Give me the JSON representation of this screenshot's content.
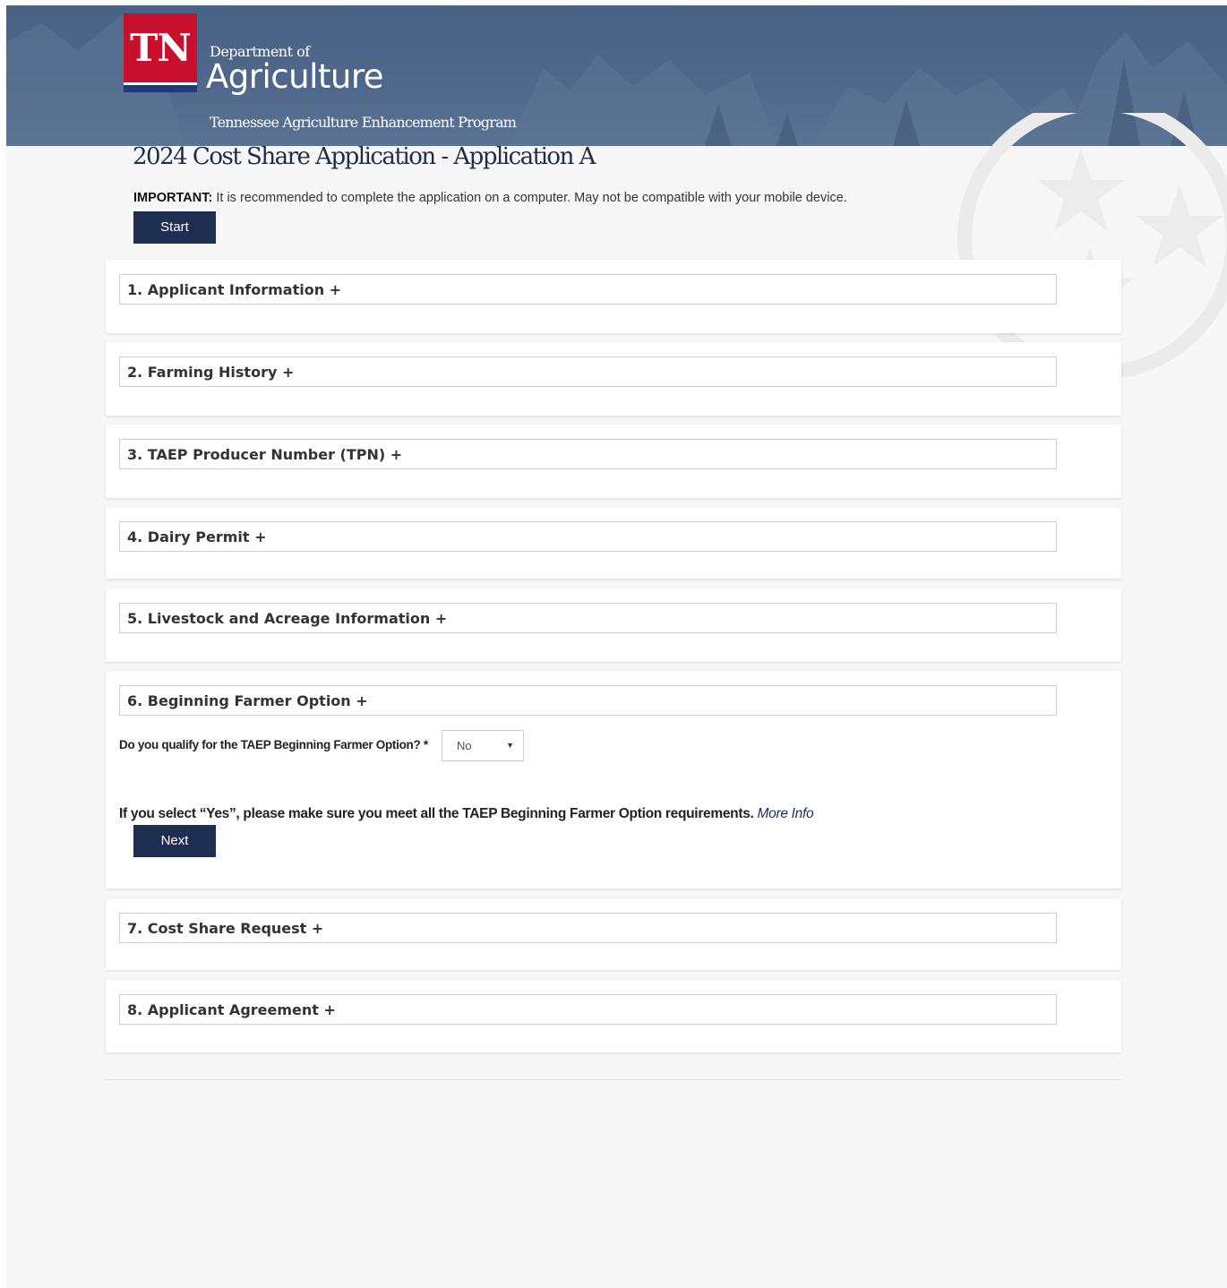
{
  "header": {
    "logo_text": "TN",
    "department": "Department of",
    "agency": "Agriculture",
    "program": "Tennessee Agriculture Enhancement Program"
  },
  "page": {
    "title": "2024 Cost Share Application - Application A",
    "important_label": "IMPORTANT:",
    "important_text": " It is recommended to complete the application on a computer. May not be compatible with your mobile device.",
    "start_label": "Start"
  },
  "sections": [
    {
      "label": "1. Applicant Information +"
    },
    {
      "label": "2. Farming History +"
    },
    {
      "label": "3. TAEP Producer Number (TPN) +"
    },
    {
      "label": "4.  Dairy Permit +"
    },
    {
      "label": "5. Livestock and Acreage Information +"
    },
    {
      "label": "6. Beginning Farmer Option +"
    },
    {
      "label": "7. Cost Share Request +"
    },
    {
      "label": "8. Applicant Agreement +"
    }
  ],
  "beginning_farmer": {
    "question": "Do you qualify for the TAEP Beginning Farmer Option? *",
    "selected": "No",
    "note": "If you select “Yes”, please make sure you meet all the TAEP Beginning Farmer Option requirements. ",
    "more_info": "More Info",
    "next_label": "Next"
  },
  "colors": {
    "banner": "#4e678a",
    "logo_red": "#c8102e",
    "button": "#1d2e50"
  }
}
